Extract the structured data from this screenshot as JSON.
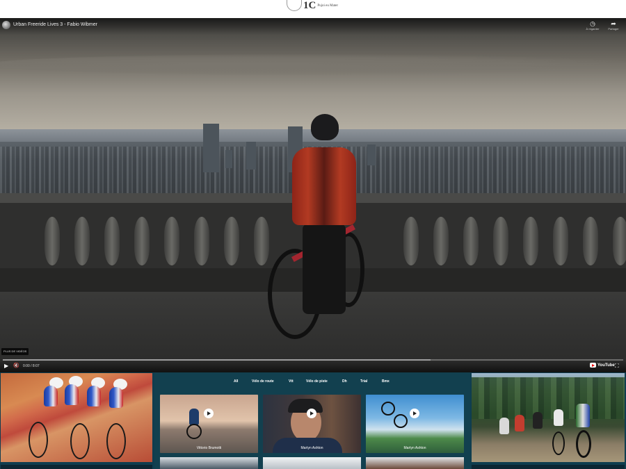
{
  "header": {
    "logo_mark": "1C",
    "logo_sub": "Pujoi eu Mater"
  },
  "video": {
    "title": "Urban Freeride Lives 3 - Fabio Wibmer",
    "actions": [
      {
        "icon": "clock-icon",
        "glyph": "◷",
        "label": "À regarder"
      },
      {
        "icon": "share-icon",
        "glyph": "➦",
        "label": "Partager"
      }
    ],
    "more_videos": "PLUS DE VIDÉOS",
    "time": "0:00 / 8:07",
    "progress": 0.0,
    "buffered": 0.69,
    "controls": {
      "play": "▶",
      "mute": "🔇",
      "fullscreen": "⛶"
    },
    "brand": "YouTube"
  },
  "gallery": {
    "categories": [
      "All",
      "Vélo de route",
      "Vtt",
      "Vélo de piste",
      "Dh",
      "Trial",
      "Bmx"
    ],
    "cards": [
      {
        "label": "Vittorio Brumotti"
      },
      {
        "label": "Martyn Ashton"
      },
      {
        "label": "Martyn Ashton"
      }
    ]
  },
  "colors": {
    "gallery_bg": "#0f3d4f",
    "progress": "#e00000"
  }
}
